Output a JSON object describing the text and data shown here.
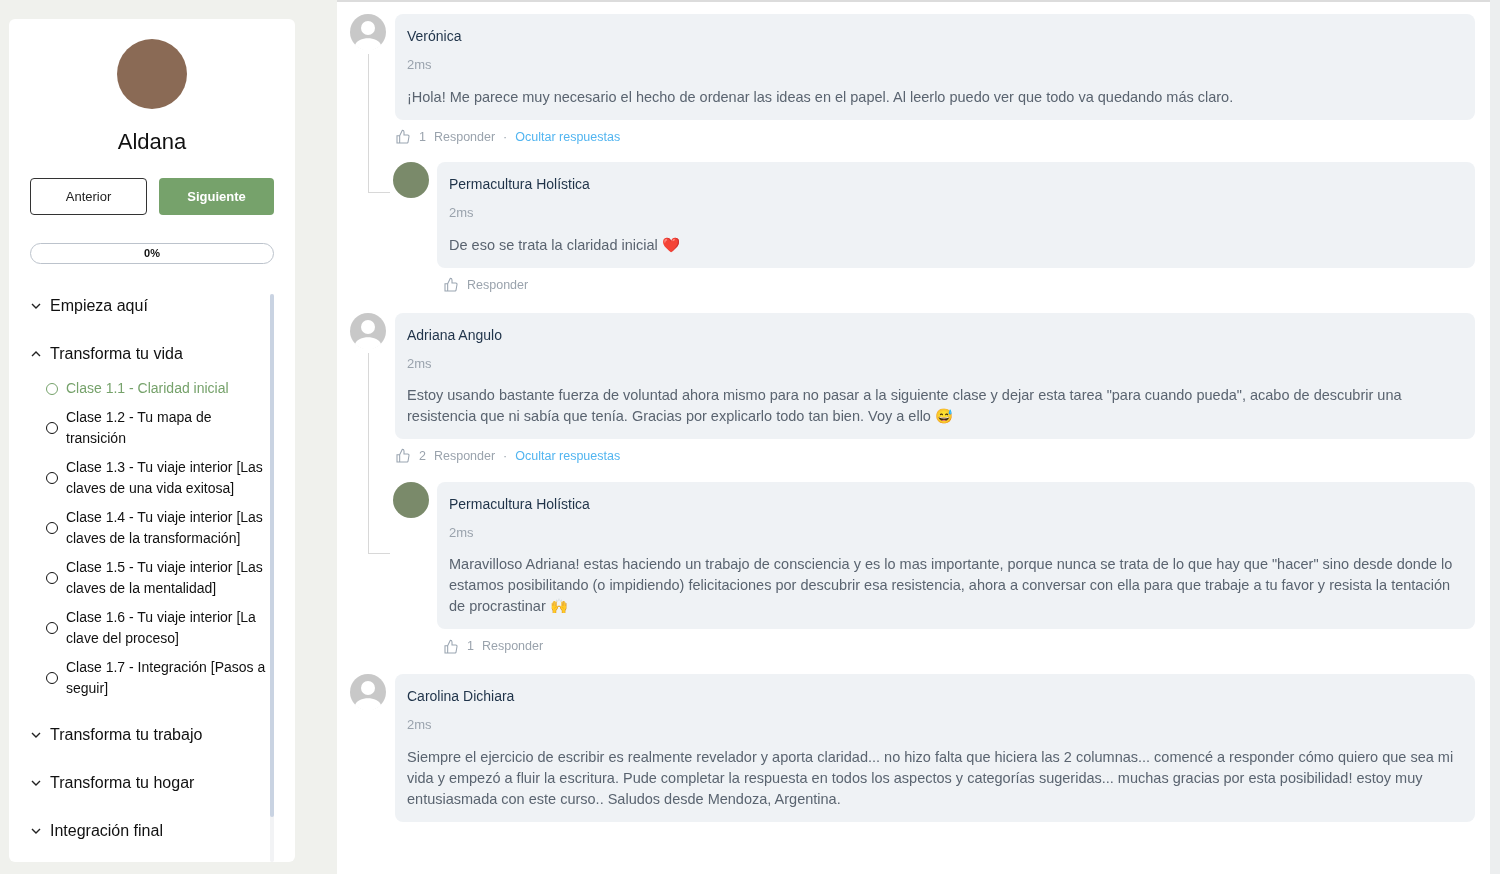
{
  "profile": {
    "name": "Aldana"
  },
  "nav_buttons": {
    "previous": "Anterior",
    "next": "Siguiente"
  },
  "progress": {
    "label": "0%",
    "level": 0
  },
  "modules": [
    {
      "title": "Empieza aquí",
      "expanded": false
    },
    {
      "title": "Transforma tu vida",
      "expanded": true,
      "lessons": [
        {
          "title": "Clase 1.1 - Claridad inicial",
          "selected": true
        },
        {
          "title": "Clase 1.2 - Tu mapa de transición",
          "selected": false
        },
        {
          "title": "Clase 1.3 - Tu viaje interior [Las claves de una vida exitosa]",
          "selected": false
        },
        {
          "title": "Clase 1.4 - Tu viaje interior [Las claves de la transformación]",
          "selected": false
        },
        {
          "title": "Clase 1.5 - Tu viaje interior [Las claves de la mentalidad]",
          "selected": false
        },
        {
          "title": "Clase 1.6 - Tu viaje interior [La clave del proceso]",
          "selected": false
        },
        {
          "title": "Clase 1.7 - Integración [Pasos a seguir]",
          "selected": false
        }
      ]
    },
    {
      "title": "Transforma tu trabajo",
      "expanded": false
    },
    {
      "title": "Transforma tu hogar",
      "expanded": false
    },
    {
      "title": "Integración final",
      "expanded": false
    }
  ],
  "comments": [
    {
      "author": "Verónica",
      "kind": "generic",
      "time": "2ms",
      "text": "¡Hola! Me parece muy necesario el hecho de ordenar las ideas en el papel. Al leerlo puedo ver que todo va quedando más claro.",
      "likes": "1",
      "reply": "Responder",
      "separator": "·",
      "hide": "Ocultar respuestas",
      "replies": [
        {
          "author": "Permacultura Holística",
          "kind": "photo",
          "time": "2ms",
          "text": "De eso se trata la claridad inicial ❤️",
          "reply": "Responder"
        }
      ]
    },
    {
      "author": "Adriana Angulo",
      "kind": "generic",
      "time": "2ms",
      "text": "Estoy usando bastante fuerza de voluntad ahora mismo para no pasar a la siguiente clase y dejar esta tarea \"para cuando pueda\", acabo de descubrir una resistencia que ni sabía que tenía. Gracias por explicarlo todo tan bien. Voy a ello 😅",
      "likes": "2",
      "reply": "Responder",
      "separator": "·",
      "hide": "Ocultar respuestas",
      "replies": [
        {
          "author": "Permacultura Holística",
          "kind": "photo",
          "time": "2ms",
          "text": "Maravilloso Adriana! estas haciendo un trabajo de consciencia y es lo mas importante, porque nunca se trata de lo que hay que \"hacer\" sino desde donde lo estamos posibilitando (o impidiendo) felicitaciones por descubrir esa resistencia, ahora a conversar con ella para que trabaje a tu favor y resista la tentación de procrastinar 🙌",
          "likes": "1",
          "reply": "Responder"
        }
      ]
    },
    {
      "author": "Carolina Dichiara",
      "kind": "generic",
      "time": "2ms",
      "text": "Siempre el ejercicio de escribir es realmente revelador y aporta claridad... no hizo falta que hiciera las 2 columnas... comencé a responder cómo quiero que sea mi vida y empezó a fluir la escritura. Pude completar la respuesta en todos los aspectos y categorías sugeridas... muchas gracias por esta posibilidad! estoy muy entusiasmada con este curso.. Saludos desde Mendoza, Argentina."
    }
  ]
}
